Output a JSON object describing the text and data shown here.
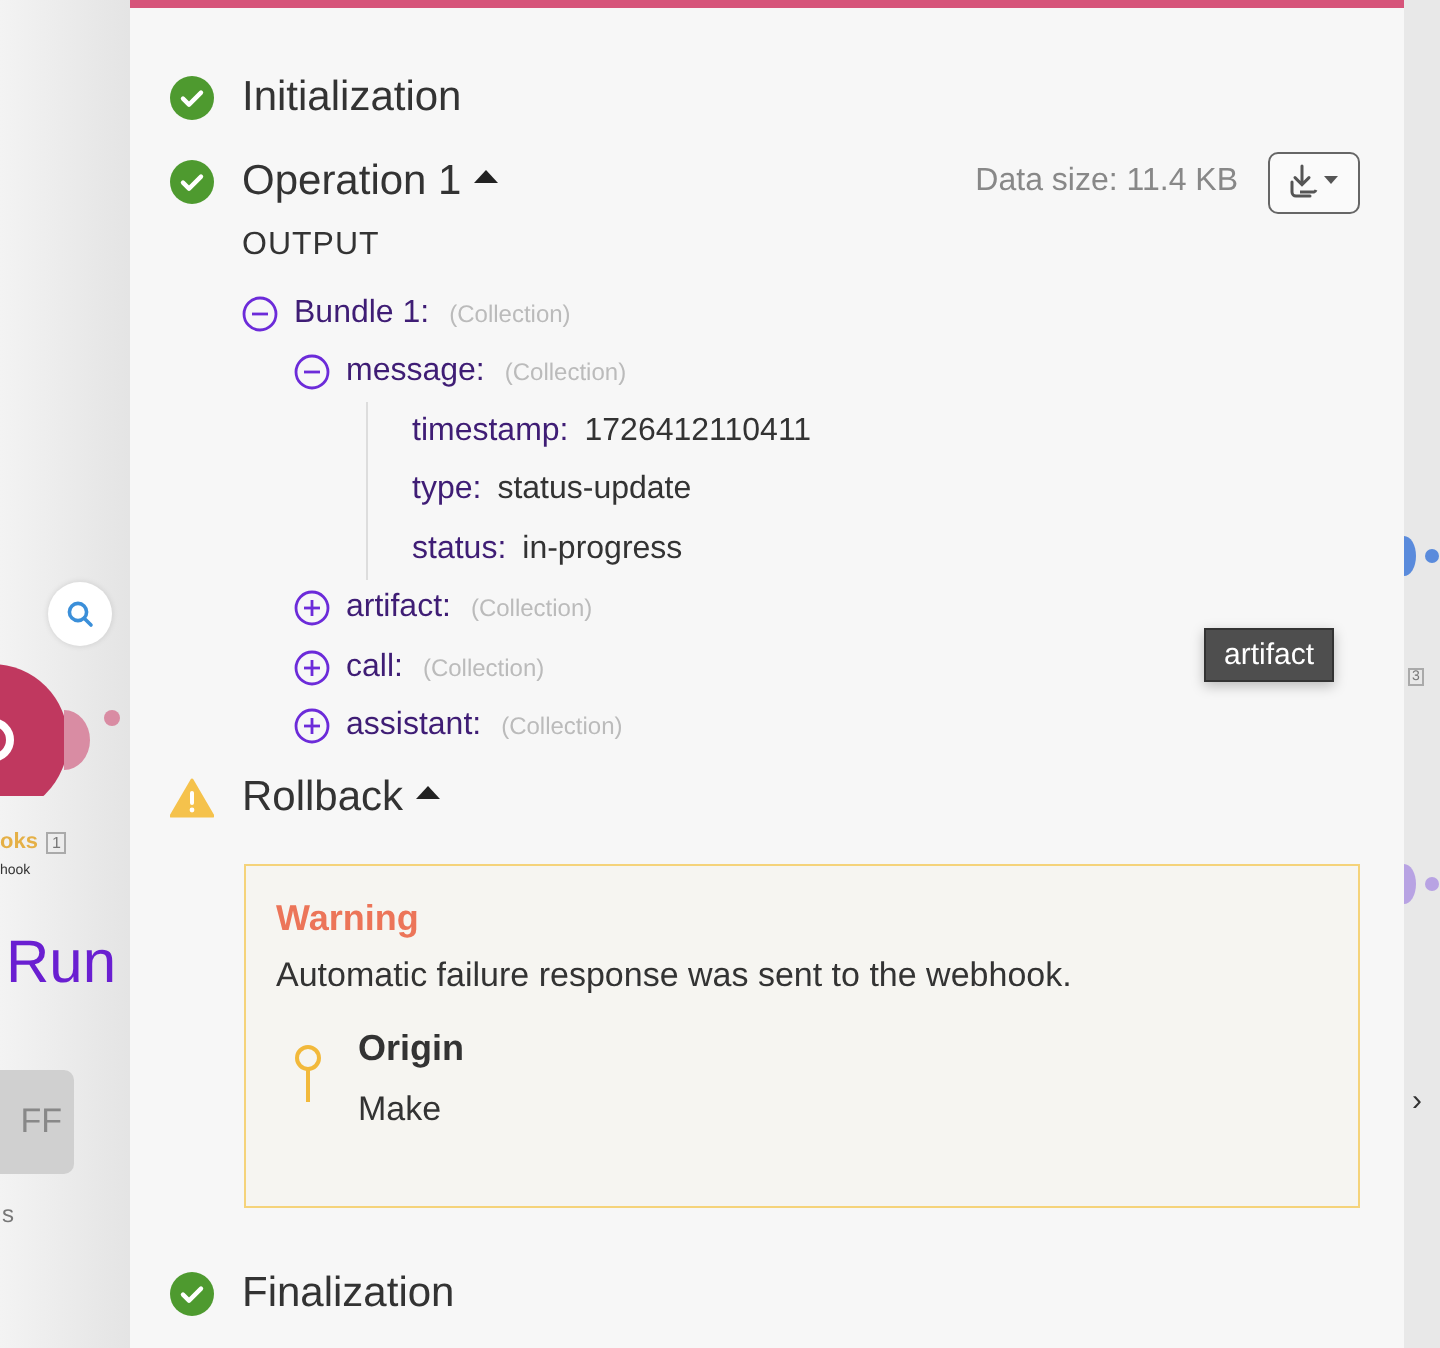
{
  "canvas": {
    "module_label": "oks",
    "module_badge": "1",
    "module_sublabel": "hook",
    "run_label": "Run",
    "toggle_label": "FF",
    "footer_text": "s",
    "right_badge": "3",
    "right_arrow": "›"
  },
  "panel": {
    "steps": [
      {
        "kind": "success",
        "title": "Initialization"
      },
      {
        "kind": "success",
        "title": "Operation 1",
        "expanded": true,
        "data_size": "Data size: 11.4 KB",
        "output": {
          "heading": "OUTPUT",
          "tree": [
            {
              "key": "Bundle 1:",
              "type": "(Collection)",
              "expanded": true,
              "children": [
                {
                  "key": "message:",
                  "type": "(Collection)",
                  "expanded": true,
                  "children": [
                    {
                      "key": "timestamp:",
                      "value": "1726412110411"
                    },
                    {
                      "key": "type:",
                      "value": "status-update"
                    },
                    {
                      "key": "status:",
                      "value": "in-progress"
                    }
                  ]
                },
                {
                  "key": "artifact:",
                  "type": "(Collection)",
                  "expanded": false
                },
                {
                  "key": "call:",
                  "type": "(Collection)",
                  "expanded": false
                },
                {
                  "key": "assistant:",
                  "type": "(Collection)",
                  "expanded": false
                }
              ]
            }
          ]
        }
      },
      {
        "kind": "warning",
        "title": "Rollback",
        "expanded": true,
        "alert": {
          "title": "Warning",
          "message": "Automatic failure response was sent to the webhook.",
          "origin_label": "Origin",
          "origin_value": "Make"
        }
      },
      {
        "kind": "success",
        "title": "Finalization"
      }
    ]
  },
  "tooltip": "artifact"
}
